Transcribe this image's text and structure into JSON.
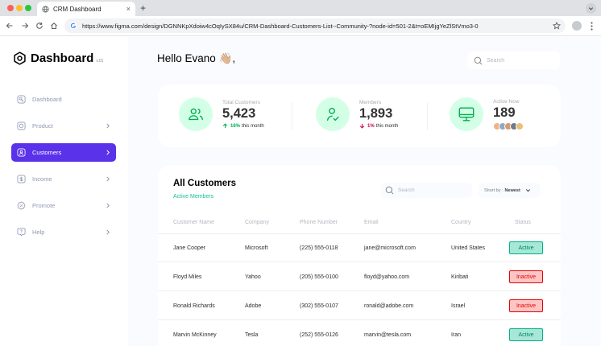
{
  "browser": {
    "tab_title": "CRM Dashboard",
    "tab_close": "×",
    "new_tab": "+",
    "url": "https://www.figma.com/design/DGNNKpXdoiw4cOqIySX84u/CRM-Dashboard-Customers-List--Community-?node-id=501-2&t=oEMIjgYeZlStVmo3-0"
  },
  "sidebar": {
    "brand_title": "Dashboard",
    "brand_version": "v.01",
    "items": [
      {
        "label": "Dashboard",
        "icon": "key-icon",
        "active": false,
        "chevron": false
      },
      {
        "label": "Product",
        "icon": "cube-icon",
        "active": false,
        "chevron": true
      },
      {
        "label": "Customers",
        "icon": "user-square-icon",
        "active": true,
        "chevron": true
      },
      {
        "label": "Income",
        "icon": "wallet-icon",
        "active": false,
        "chevron": true
      },
      {
        "label": "Promote",
        "icon": "discount-icon",
        "active": false,
        "chevron": true
      },
      {
        "label": "Help",
        "icon": "message-question-icon",
        "active": false,
        "chevron": true
      }
    ]
  },
  "header": {
    "greeting": "Hello Evano 👋🏼,",
    "search_placeholder": "Search"
  },
  "stats": [
    {
      "label": "Total Customers",
      "value": "5,423",
      "change_pct": "16%",
      "change_text": "this month",
      "direction": "up"
    },
    {
      "label": "Members",
      "value": "1,893",
      "change_pct": "1%",
      "change_text": "this month",
      "direction": "down"
    },
    {
      "label": "Active Now",
      "value": "189",
      "avatars": [
        "#f4b183",
        "#8fa8c8",
        "#d99a6c",
        "#6d7b8d",
        "#e8c07a"
      ]
    }
  ],
  "customers": {
    "title": "All Customers",
    "subtitle": "Active Members",
    "search_placeholder": "Search",
    "sort_label": "Short by :",
    "sort_value": "Newest",
    "columns": [
      "Customer Name",
      "Company",
      "Phone Number",
      "Email",
      "Country",
      "Status"
    ],
    "rows": [
      {
        "name": "Jane Cooper",
        "company": "Microsoft",
        "phone": "(225) 555-0118",
        "email": "jane@microsoft.com",
        "country": "United States",
        "status": "Active"
      },
      {
        "name": "Floyd Miles",
        "company": "Yahoo",
        "phone": "(205) 555-0100",
        "email": "floyd@yahoo.com",
        "country": "Kiribati",
        "status": "Inactive"
      },
      {
        "name": "Ronald Richards",
        "company": "Adobe",
        "phone": "(302) 555-0107",
        "email": "ronald@adobe.com",
        "country": "Israel",
        "status": "Inactive"
      },
      {
        "name": "Marvin McKinney",
        "company": "Tesla",
        "phone": "(252) 555-0126",
        "email": "marvin@tesla.com",
        "country": "Iran",
        "status": "Active"
      }
    ]
  },
  "colors": {
    "accent": "#5932ea",
    "success": "#00ac4f",
    "danger": "#d0004b",
    "stat_circle": "#d3ffe7"
  }
}
